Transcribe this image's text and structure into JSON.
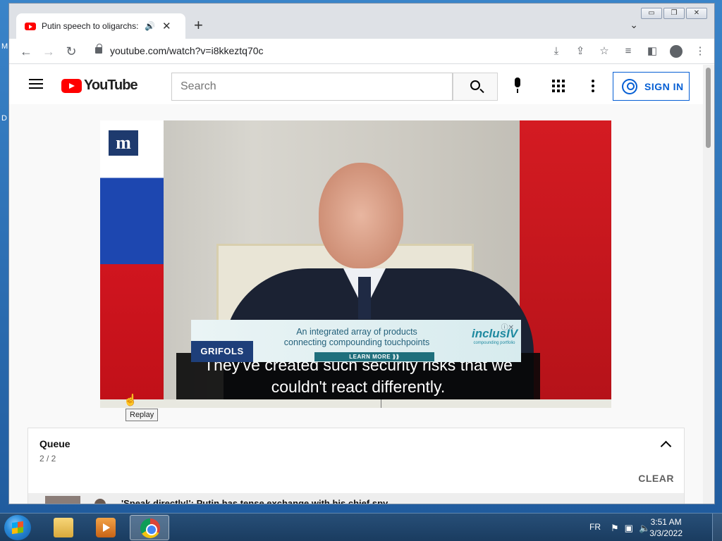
{
  "desktop": {
    "edge_letters": [
      "M",
      "D"
    ]
  },
  "browser": {
    "tab": {
      "title": "Putin speech to oligarchs: Ru",
      "audio_icon": "speaker-icon",
      "close": "✕"
    },
    "new_tab": "+",
    "window_controls": [
      "▭",
      "❐",
      "✕"
    ],
    "address": {
      "url": "youtube.com/watch?v=i8kkeztq70c"
    },
    "toolbar_icons": [
      "install-icon",
      "share-icon",
      "star-icon",
      "media-queue-icon",
      "side-panel-icon",
      "profile-icon",
      "menu-icon"
    ]
  },
  "youtube": {
    "logo_text": "YouTube",
    "search": {
      "placeholder": "Search"
    },
    "signin_label": "SIGN IN",
    "player": {
      "subtitle_line1": "They've created such security risks that we",
      "subtitle_line2": "couldn't react differently.",
      "ad": {
        "brand": "GRIFOLS",
        "line1": "An integrated array of products",
        "line2": "connecting compounding touchpoints",
        "cta": "LEARN MORE ⟫⟫",
        "logo_name": "inclusIV",
        "logo_tag": "compounding portfolio"
      },
      "tooltip": "Replay",
      "publisher_logo": "m"
    },
    "queue": {
      "title": "Queue",
      "count": "2 / 2",
      "clear_label": "CLEAR",
      "items": [
        {
          "title": "'Speak directly!': Putin has tense exchange with his chief spy"
        }
      ]
    }
  },
  "taskbar": {
    "language": "FR",
    "time": "3:51 AM",
    "date": "3/3/2022",
    "tray_icons": [
      "action-center-icon",
      "network-icon",
      "volume-icon"
    ]
  }
}
